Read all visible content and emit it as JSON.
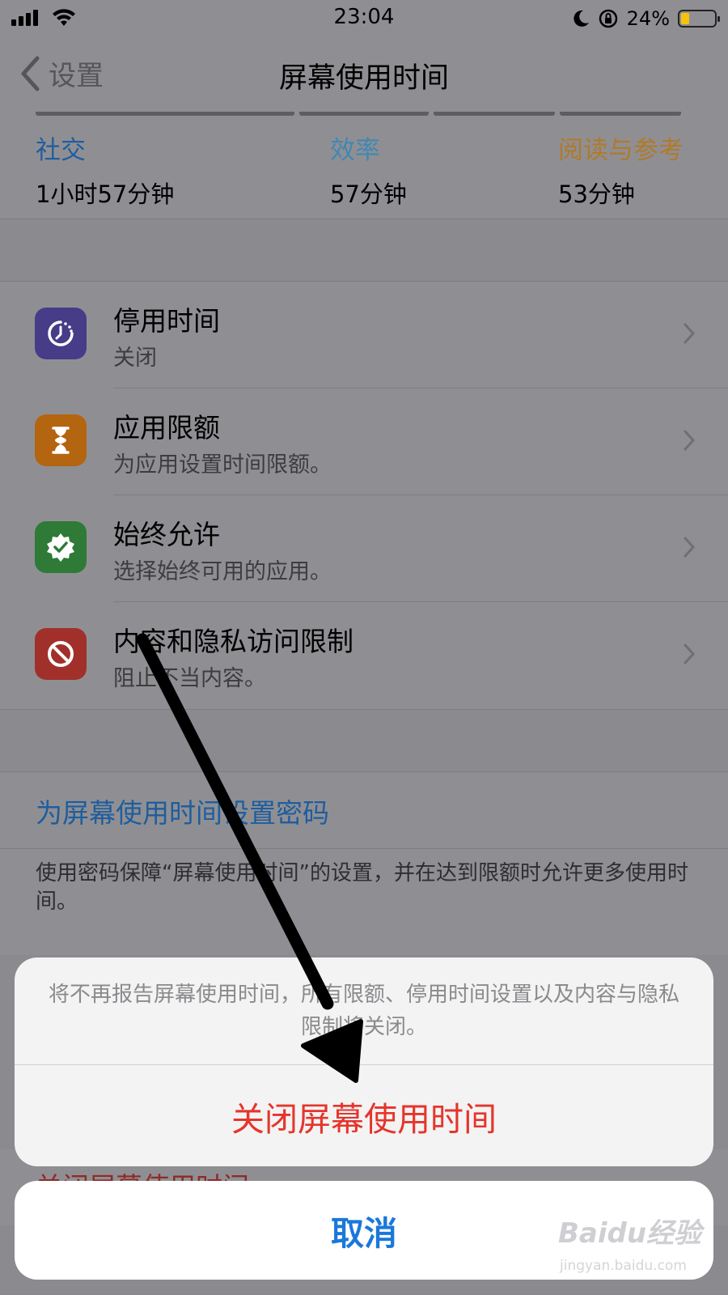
{
  "status_bar": {
    "time": "23:04",
    "battery_text": "24%",
    "battery_level": 0.24
  },
  "nav": {
    "back_label": "设置",
    "title": "屏幕使用时间"
  },
  "usage": {
    "categories": [
      {
        "name": "社交",
        "duration": "1小时57分钟",
        "color": "#1f5d9e"
      },
      {
        "name": "效率",
        "duration": "57分钟",
        "color": "#3f88b3"
      },
      {
        "name": "阅读与参考",
        "duration": "53分钟",
        "color": "#b07a2a"
      }
    ]
  },
  "menu": {
    "items": [
      {
        "title": "停用时间",
        "subtitle": "关闭",
        "icon": "downtime-icon",
        "icon_color": "#463c87"
      },
      {
        "title": "应用限额",
        "subtitle": "为应用设置时间限额。",
        "icon": "hourglass-icon",
        "icon_color": "#b4650f"
      },
      {
        "title": "始终允许",
        "subtitle": "选择始终可用的应用。",
        "icon": "check-badge-icon",
        "icon_color": "#2f7a37"
      },
      {
        "title": "内容和隐私访问限制",
        "subtitle": "阻止不当内容。",
        "icon": "no-entry-icon",
        "icon_color": "#a1302b"
      }
    ]
  },
  "passcode": {
    "label": "为屏幕使用时间设置密码",
    "note": "使用密码保障“屏幕使用时间”的设置，并在达到限额时允许更多使用时间。"
  },
  "hidden_row": {
    "label": "关闭屏幕使用时间"
  },
  "action_sheet": {
    "message": "将不再报告屏幕使用时间，所有限额、停用时间设置以及内容与隐私限制将关闭。",
    "destructive_label": "关闭屏幕使用时间",
    "cancel_label": "取消"
  },
  "watermark": {
    "logo_text": "Baidu经验",
    "url_text": "jingyan.baidu.com"
  }
}
